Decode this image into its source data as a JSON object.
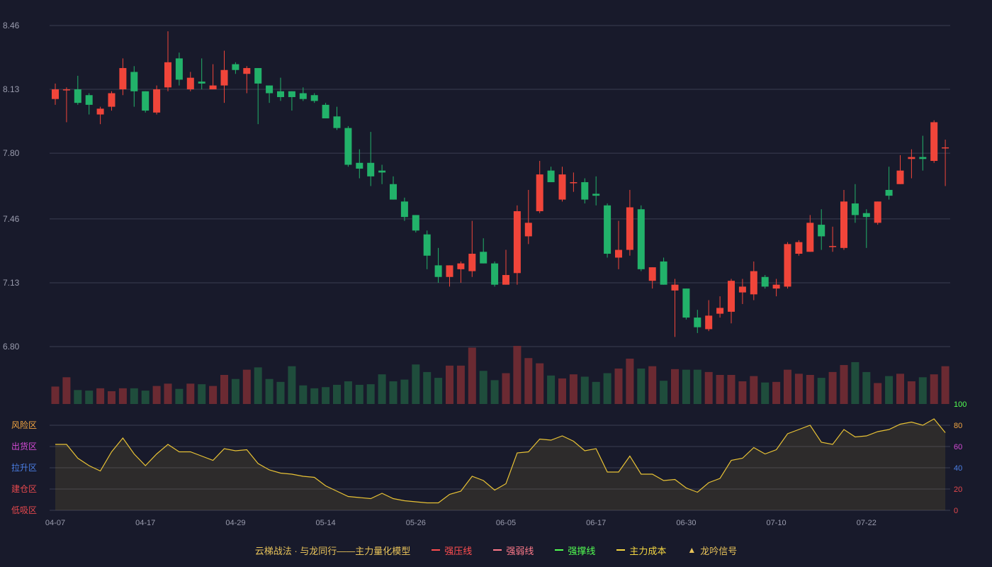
{
  "chart_data": {
    "type": "candlestick",
    "title": "云梯战法 · 与龙同行——主力量化模型",
    "price_axis": {
      "ticks": [
        "8.46",
        "8.13",
        "7.80",
        "7.46",
        "7.13",
        "6.80"
      ],
      "ylim": [
        6.8,
        8.46
      ]
    },
    "indicator_axis": {
      "ticks_right": [
        "100",
        "80",
        "60",
        "40",
        "20",
        "0"
      ],
      "ylim": [
        0,
        100
      ]
    },
    "zones": [
      {
        "label": "风险区",
        "value": 80,
        "color": "#f4a742"
      },
      {
        "label": "出货区",
        "value": 60,
        "color": "#d44bd6"
      },
      {
        "label": "拉升区",
        "value": 40,
        "color": "#4b7fe6"
      },
      {
        "label": "建仓区",
        "value": 20,
        "color": "#e5484d"
      },
      {
        "label": "低吸区",
        "value": 0,
        "color": "#e5484d"
      }
    ],
    "x_labels": [
      {
        "i": 0,
        "label": "04-07"
      },
      {
        "i": 8,
        "label": "04-17"
      },
      {
        "i": 16,
        "label": "04-29"
      },
      {
        "i": 24,
        "label": "05-14"
      },
      {
        "i": 32,
        "label": "05-26"
      },
      {
        "i": 40,
        "label": "06-05"
      },
      {
        "i": 48,
        "label": "06-17"
      },
      {
        "i": 56,
        "label": "06-30"
      },
      {
        "i": 64,
        "label": "07-10"
      },
      {
        "i": 72,
        "label": "07-22"
      }
    ],
    "candles": [
      [
        8.08,
        8.13,
        8.05,
        8.16
      ],
      [
        8.13,
        8.13,
        7.96,
        8.14
      ],
      [
        8.13,
        8.06,
        8.05,
        8.2
      ],
      [
        8.1,
        8.05,
        8.0,
        8.11
      ],
      [
        8.0,
        8.03,
        7.95,
        8.04
      ],
      [
        8.04,
        8.11,
        8.02,
        8.12
      ],
      [
        8.13,
        8.24,
        8.1,
        8.29
      ],
      [
        8.22,
        8.12,
        8.04,
        8.25
      ],
      [
        8.12,
        8.02,
        8.01,
        8.12
      ],
      [
        8.01,
        8.13,
        8.0,
        8.15
      ],
      [
        8.14,
        8.27,
        8.12,
        8.43
      ],
      [
        8.29,
        8.18,
        8.15,
        8.32
      ],
      [
        8.13,
        8.19,
        8.12,
        8.22
      ],
      [
        8.17,
        8.16,
        8.13,
        8.29
      ],
      [
        8.13,
        8.15,
        8.13,
        8.26
      ],
      [
        8.15,
        8.23,
        8.06,
        8.33
      ],
      [
        8.26,
        8.23,
        8.21,
        8.27
      ],
      [
        8.21,
        8.24,
        8.11,
        8.25
      ],
      [
        8.24,
        8.16,
        7.95,
        8.24
      ],
      [
        8.15,
        8.11,
        8.06,
        8.15
      ],
      [
        8.12,
        8.09,
        8.07,
        8.19
      ],
      [
        8.12,
        8.09,
        8.02,
        8.12
      ],
      [
        8.11,
        8.08,
        8.07,
        8.14
      ],
      [
        8.1,
        8.07,
        8.06,
        8.11
      ],
      [
        8.05,
        7.98,
        7.98,
        8.06
      ],
      [
        7.99,
        7.93,
        7.92,
        8.04
      ],
      [
        7.93,
        7.74,
        7.73,
        7.94
      ],
      [
        7.75,
        7.72,
        7.67,
        7.82
      ],
      [
        7.75,
        7.68,
        7.63,
        7.91
      ],
      [
        7.71,
        7.7,
        7.64,
        7.74
      ],
      [
        7.64,
        7.56,
        7.56,
        7.68
      ],
      [
        7.55,
        7.47,
        7.45,
        7.57
      ],
      [
        7.48,
        7.4,
        7.39,
        7.48
      ],
      [
        7.38,
        7.27,
        7.2,
        7.4
      ],
      [
        7.22,
        7.16,
        7.13,
        7.31
      ],
      [
        7.16,
        7.22,
        7.11,
        7.22
      ],
      [
        7.2,
        7.23,
        7.13,
        7.24
      ],
      [
        7.19,
        7.28,
        7.16,
        7.45
      ],
      [
        7.29,
        7.23,
        7.23,
        7.36
      ],
      [
        7.23,
        7.12,
        7.11,
        7.24
      ],
      [
        7.12,
        7.17,
        7.12,
        7.3
      ],
      [
        7.18,
        7.5,
        7.12,
        7.53
      ],
      [
        7.37,
        7.44,
        7.33,
        7.61
      ],
      [
        7.5,
        7.69,
        7.49,
        7.76
      ],
      [
        7.71,
        7.65,
        7.65,
        7.73
      ],
      [
        7.56,
        7.69,
        7.55,
        7.73
      ],
      [
        7.65,
        7.65,
        7.6,
        7.7
      ],
      [
        7.65,
        7.56,
        7.54,
        7.67
      ],
      [
        7.59,
        7.58,
        7.53,
        7.68
      ],
      [
        7.53,
        7.28,
        7.26,
        7.54
      ],
      [
        7.26,
        7.3,
        7.2,
        7.45
      ],
      [
        7.3,
        7.52,
        7.27,
        7.61
      ],
      [
        7.51,
        7.2,
        7.19,
        7.53
      ],
      [
        7.14,
        7.21,
        7.1,
        7.21
      ],
      [
        7.24,
        7.12,
        7.12,
        7.26
      ],
      [
        7.09,
        7.12,
        6.85,
        7.15
      ],
      [
        7.1,
        6.95,
        6.94,
        7.1
      ],
      [
        6.95,
        6.9,
        6.87,
        6.99
      ],
      [
        6.89,
        6.96,
        6.88,
        7.04
      ],
      [
        6.97,
        7.0,
        6.95,
        7.06
      ],
      [
        6.98,
        7.14,
        6.92,
        7.15
      ],
      [
        7.08,
        7.11,
        7.02,
        7.15
      ],
      [
        7.07,
        7.19,
        7.04,
        7.24
      ],
      [
        7.16,
        7.11,
        7.1,
        7.17
      ],
      [
        7.1,
        7.12,
        7.06,
        7.15
      ],
      [
        7.11,
        7.33,
        7.1,
        7.34
      ],
      [
        7.28,
        7.34,
        7.27,
        7.35
      ],
      [
        7.29,
        7.44,
        7.29,
        7.48
      ],
      [
        7.43,
        7.37,
        7.3,
        7.51
      ],
      [
        7.32,
        7.32,
        7.29,
        7.42
      ],
      [
        7.31,
        7.55,
        7.3,
        7.61
      ],
      [
        7.54,
        7.48,
        7.44,
        7.64
      ],
      [
        7.49,
        7.47,
        7.31,
        7.51
      ],
      [
        7.44,
        7.55,
        7.43,
        7.55
      ],
      [
        7.61,
        7.58,
        7.56,
        7.73
      ],
      [
        7.64,
        7.71,
        7.64,
        7.79
      ],
      [
        7.77,
        7.78,
        7.67,
        7.82
      ],
      [
        7.78,
        7.77,
        7.71,
        7.89
      ],
      [
        7.76,
        7.96,
        7.75,
        7.97
      ],
      [
        7.83,
        7.83,
        7.63,
        7.87
      ]
    ],
    "volumes": [
      0.3,
      0.46,
      0.24,
      0.23,
      0.27,
      0.22,
      0.27,
      0.27,
      0.23,
      0.31,
      0.35,
      0.26,
      0.35,
      0.34,
      0.31,
      0.5,
      0.43,
      0.59,
      0.63,
      0.43,
      0.38,
      0.65,
      0.32,
      0.27,
      0.29,
      0.33,
      0.39,
      0.33,
      0.34,
      0.51,
      0.39,
      0.42,
      0.68,
      0.55,
      0.45,
      0.66,
      0.66,
      0.97,
      0.57,
      0.41,
      0.53,
      1.0,
      0.79,
      0.7,
      0.49,
      0.44,
      0.51,
      0.47,
      0.38,
      0.53,
      0.61,
      0.78,
      0.61,
      0.65,
      0.4,
      0.6,
      0.59,
      0.59,
      0.55,
      0.5,
      0.5,
      0.39,
      0.48,
      0.37,
      0.38,
      0.59,
      0.52,
      0.5,
      0.45,
      0.55,
      0.67,
      0.72,
      0.55,
      0.36,
      0.48,
      0.52,
      0.39,
      0.46,
      0.51,
      0.65
    ],
    "indicator": [
      62,
      62,
      49,
      42,
      37,
      55,
      68,
      53,
      42,
      53,
      62,
      55,
      55,
      51,
      47,
      58,
      56,
      57,
      44,
      38,
      35,
      34,
      32,
      31,
      23,
      18,
      13,
      12,
      11,
      16,
      11,
      9,
      8,
      7,
      7,
      15,
      18,
      32,
      28,
      19,
      25,
      54,
      55,
      67,
      66,
      70,
      65,
      56,
      58,
      36,
      36,
      51,
      34,
      34,
      28,
      29,
      21,
      17,
      26,
      30,
      47,
      49,
      59,
      53,
      57,
      72,
      76,
      80,
      64,
      62,
      76,
      69,
      70,
      74,
      76,
      81,
      83,
      80,
      86,
      73
    ]
  },
  "legend": {
    "title": "云梯战法 · 与龙同行——主力量化模型",
    "items": [
      {
        "label": "强压线",
        "color": "#ff4d4f",
        "style": "solid"
      },
      {
        "label": "强弱线",
        "color": "#ff7a8a",
        "style": "dashed"
      },
      {
        "label": "强撑线",
        "color": "#52ff52",
        "style": "solid"
      },
      {
        "label": "主力成本",
        "color": "#f5d742",
        "style": "dashed"
      },
      {
        "label": "龙吟信号",
        "color": "#e8c35a",
        "style": "triangle"
      }
    ]
  },
  "colors": {
    "up": "#f0453a",
    "down": "#22b26a",
    "up_volume": "#6b2a32",
    "down_volume": "#1f4d3c",
    "indicator_line": "#e8c235",
    "grid": "#3a3d52",
    "axis_text": "#9a9cae"
  }
}
